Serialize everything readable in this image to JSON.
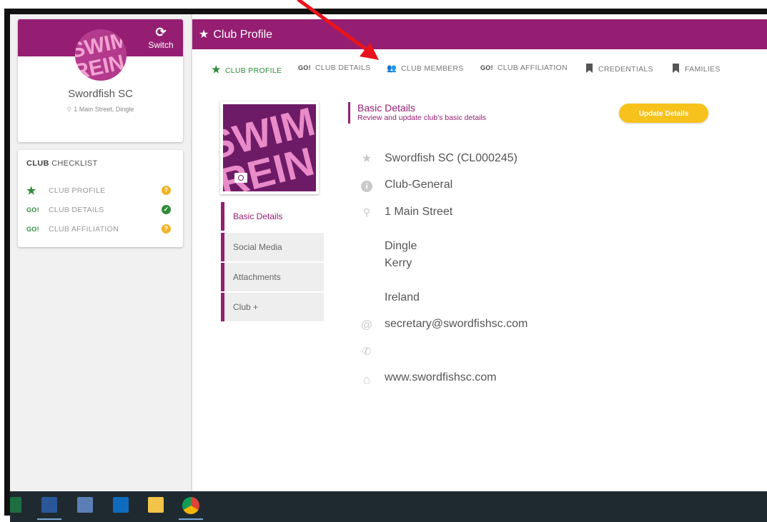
{
  "sidebar": {
    "switch_label": "Switch",
    "club_name": "Swordfish SC",
    "club_address": "1 Main Street, Dingle",
    "checklist": {
      "title_bold": "CLUB",
      "title_rest": " CHECKLIST",
      "items": [
        {
          "icon": "★",
          "label": "CLUB PROFILE",
          "status": "?"
        },
        {
          "icon": "GO!",
          "label": "CLUB DETAILS",
          "status": "✓"
        },
        {
          "icon": "GO!",
          "label": "CLUB AFFILIATION",
          "status": "?"
        }
      ]
    }
  },
  "header": {
    "title": "Club Profile"
  },
  "tabs": [
    {
      "icon": "★",
      "label": "CLUB PROFILE"
    },
    {
      "icon": "GO!",
      "label": "CLUB DETAILS"
    },
    {
      "icon": "👥",
      "label": "CLUB MEMBERS"
    },
    {
      "icon": "GO!",
      "label": "CLUB AFFILIATION"
    },
    {
      "icon": "bookmark",
      "label": "CREDENTIALS"
    },
    {
      "icon": "bookmark",
      "label": "FAMILIES"
    }
  ],
  "side_menu": [
    "Basic Details",
    "Social Media",
    "Attachments",
    "Club +"
  ],
  "basic_details": {
    "title": "Basic Details",
    "subtitle": "Review and update club's basic details",
    "update_button": "Update Details",
    "club_name_code": "Swordfish SC (CL000245)",
    "club_type": "Club-General",
    "address_line1": "1 Main Street",
    "town": "Dingle",
    "county": "Kerry",
    "country": "Ireland",
    "email": "secretary@swordfishsc.com",
    "phone": "",
    "website": "www.swordfishsc.com"
  },
  "logo_text": "SWIM REIN",
  "colors": {
    "brand": "#951e72",
    "accent": "#f8c21c",
    "success": "#2e8b3a",
    "arrow": "#e8141b"
  }
}
